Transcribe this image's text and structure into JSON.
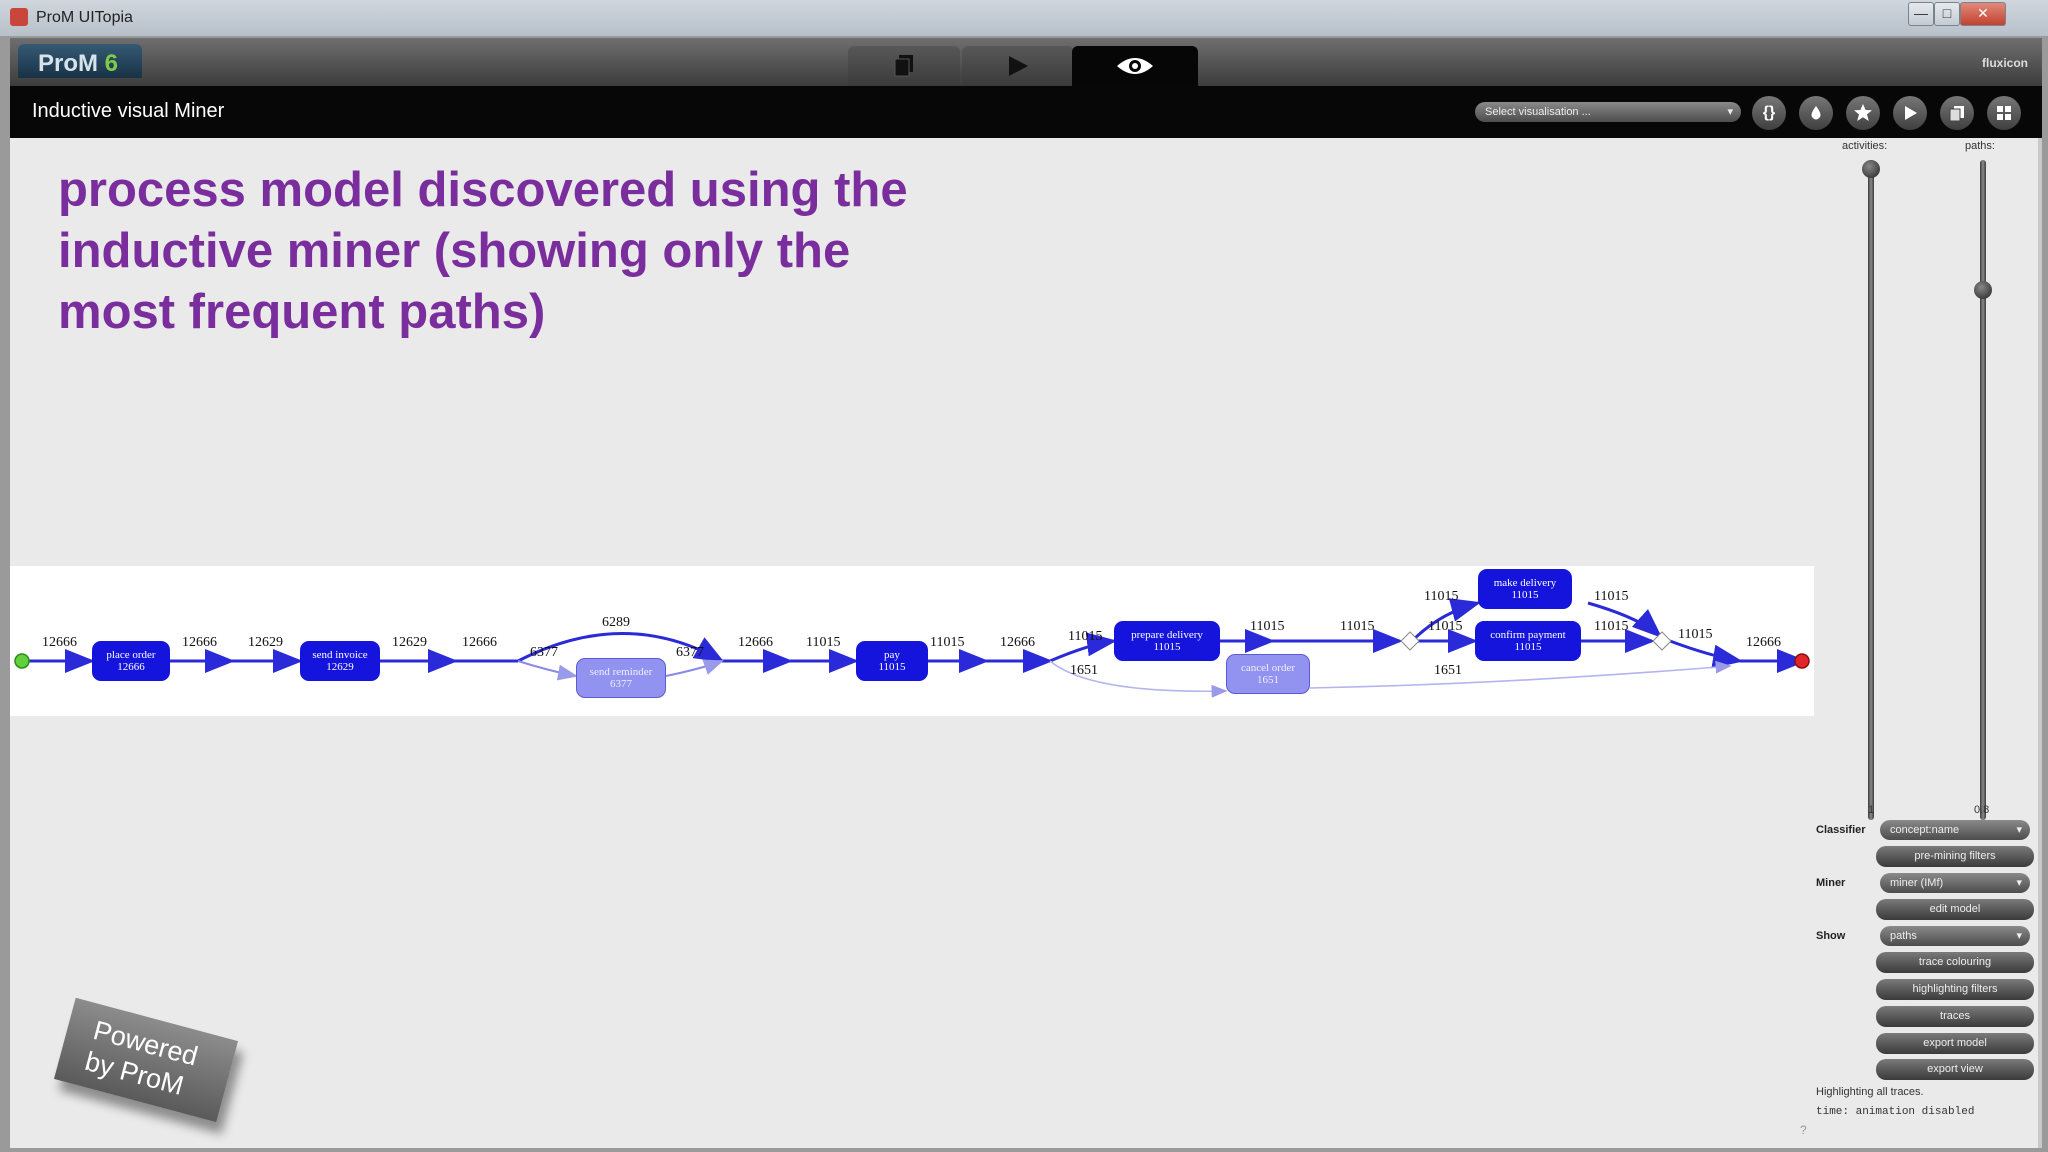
{
  "window": {
    "app_title": "ProM UITopia",
    "min_label": "—",
    "max_label": "□",
    "close_label": "✕"
  },
  "header": {
    "logo_text": "ProM",
    "logo_version": "6",
    "tabs": [
      {
        "name": "workspace",
        "icon": "document-copy-icon"
      },
      {
        "name": "actions",
        "icon": "play-icon"
      },
      {
        "name": "views",
        "icon": "eye-icon",
        "active": true
      }
    ],
    "brand": "fluxicon"
  },
  "view_bar": {
    "title": "Inductive visual Miner",
    "select_label": "Select visualisation ...",
    "controls": [
      "curly-braces-icon",
      "drop-icon",
      "star-icon",
      "play-icon",
      "copy-icon",
      "grid-icon"
    ]
  },
  "caption": "process model discovered using the inductive miner (showing only the most frequent paths)",
  "model": {
    "nodes": [
      {
        "id": "place-order",
        "label": "place order",
        "count": "12666"
      },
      {
        "id": "send-invoice",
        "label": "send invoice",
        "count": "12629"
      },
      {
        "id": "send-reminder",
        "label": "send reminder",
        "count": "6377"
      },
      {
        "id": "pay",
        "label": "pay",
        "count": "11015"
      },
      {
        "id": "prepare-delivery",
        "label": "prepare delivery",
        "count": "11015"
      },
      {
        "id": "cancel-order",
        "label": "cancel order",
        "count": "1651"
      },
      {
        "id": "make-delivery",
        "label": "make delivery",
        "count": "11015"
      },
      {
        "id": "confirm-payment",
        "label": "confirm payment",
        "count": "11015"
      }
    ],
    "edge_labels": [
      "12666",
      "12666",
      "12629",
      "12629",
      "12666",
      "6377",
      "6289",
      "6377",
      "12666",
      "11015",
      "11015",
      "12666",
      "11015",
      "1651",
      "11015",
      "11015",
      "11015",
      "11015",
      "11015",
      "11015",
      "11015",
      "1651",
      "12666"
    ]
  },
  "sliders": {
    "activities_label": "activities:",
    "paths_label": "paths:",
    "activities_value": "1",
    "paths_value": "0.8",
    "activities_level": 1.0,
    "paths_level": 0.8
  },
  "controls": {
    "classifier_label": "Classifier",
    "classifier_value": "concept:name",
    "pre_mining_filters": "pre-mining filters",
    "miner_label": "Miner",
    "miner_value": "miner (IMf)",
    "edit_model": "edit model",
    "show_label": "Show",
    "show_value": "paths",
    "trace_colouring": "trace colouring",
    "highlighting_filters": "highlighting filters",
    "traces": "traces",
    "export_model": "export model",
    "export_view": "export view",
    "status_highlighting": "Highlighting all traces.",
    "status_time": "time: animation disabled",
    "help_mark": "?"
  },
  "powered": {
    "line1": "Powered",
    "line2": "by ProM"
  },
  "colors": {
    "caption": "#7a2d9c",
    "frequent_node": "#1414dc",
    "rare_node": "#9292f0",
    "start": "#5fd13a",
    "end": "#e0262a"
  }
}
